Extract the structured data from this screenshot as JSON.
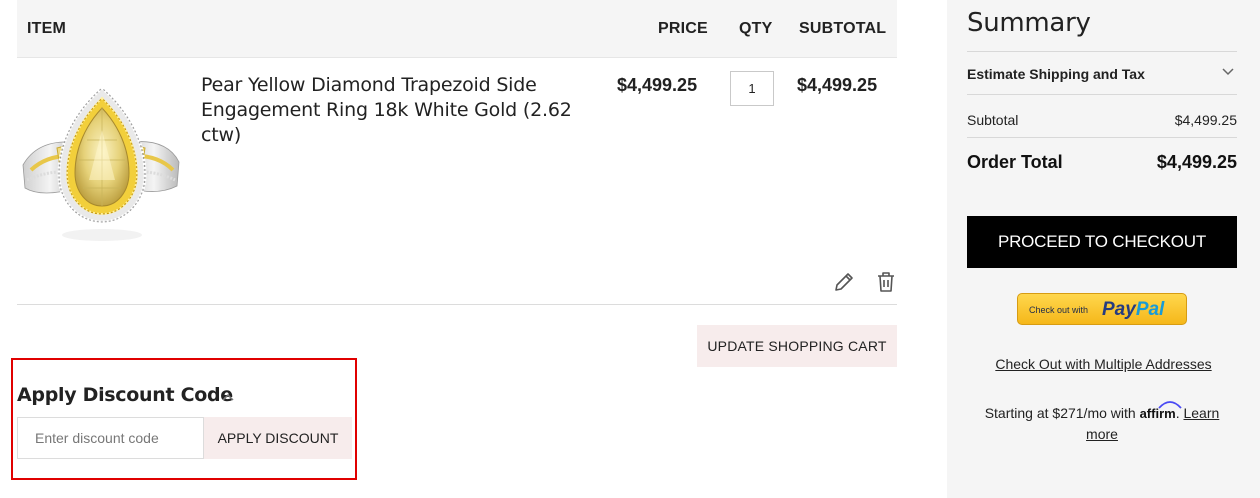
{
  "cart": {
    "headers": {
      "item": "ITEM",
      "price": "PRICE",
      "qty": "QTY",
      "subtotal": "SUBTOTAL"
    },
    "items": [
      {
        "name": "Pear Yellow Diamond Trapezoid Side Engagement Ring 18k White Gold (2.62 ctw)",
        "price": "$4,499.25",
        "qty": "1",
        "subtotal": "$4,499.25",
        "image_icon": "diamond-ring-image"
      }
    ],
    "update_label": "UPDATE SHOPPING CART",
    "edit_icon": "pencil-icon",
    "delete_icon": "trash-icon"
  },
  "discount": {
    "title": "Apply Discount Code",
    "placeholder": "Enter discount code",
    "button_label": "APPLY DISCOUNT",
    "highlight_color": "#e00000",
    "toggle_icon": "chevron-up-icon"
  },
  "summary": {
    "title": "Summary",
    "shipping_label": "Estimate Shipping and Tax",
    "shipping_icon": "chevron-down-icon",
    "subtotal_label": "Subtotal",
    "subtotal_value": "$4,499.25",
    "order_total_label": "Order Total",
    "order_total_value": "$4,499.25",
    "checkout_label": "PROCEED TO CHECKOUT",
    "paypal": {
      "prefix": "Check out with",
      "brand_a": "Pay",
      "brand_b": "Pal"
    },
    "multi_address_label": "Check Out with Multiple Addresses",
    "affirm": {
      "prefix": "Starting at $271/mo with",
      "brand": "affirm",
      "suffix": ".",
      "link": "Learn more"
    }
  },
  "colors": {
    "button_bg": "#f7ecec",
    "checkout_bg": "#000000",
    "summary_bg": "#f5f5f5",
    "paypal_gold": "#f5b71a",
    "paypal_navy": "#253b80",
    "paypal_blue": "#179bd7"
  }
}
